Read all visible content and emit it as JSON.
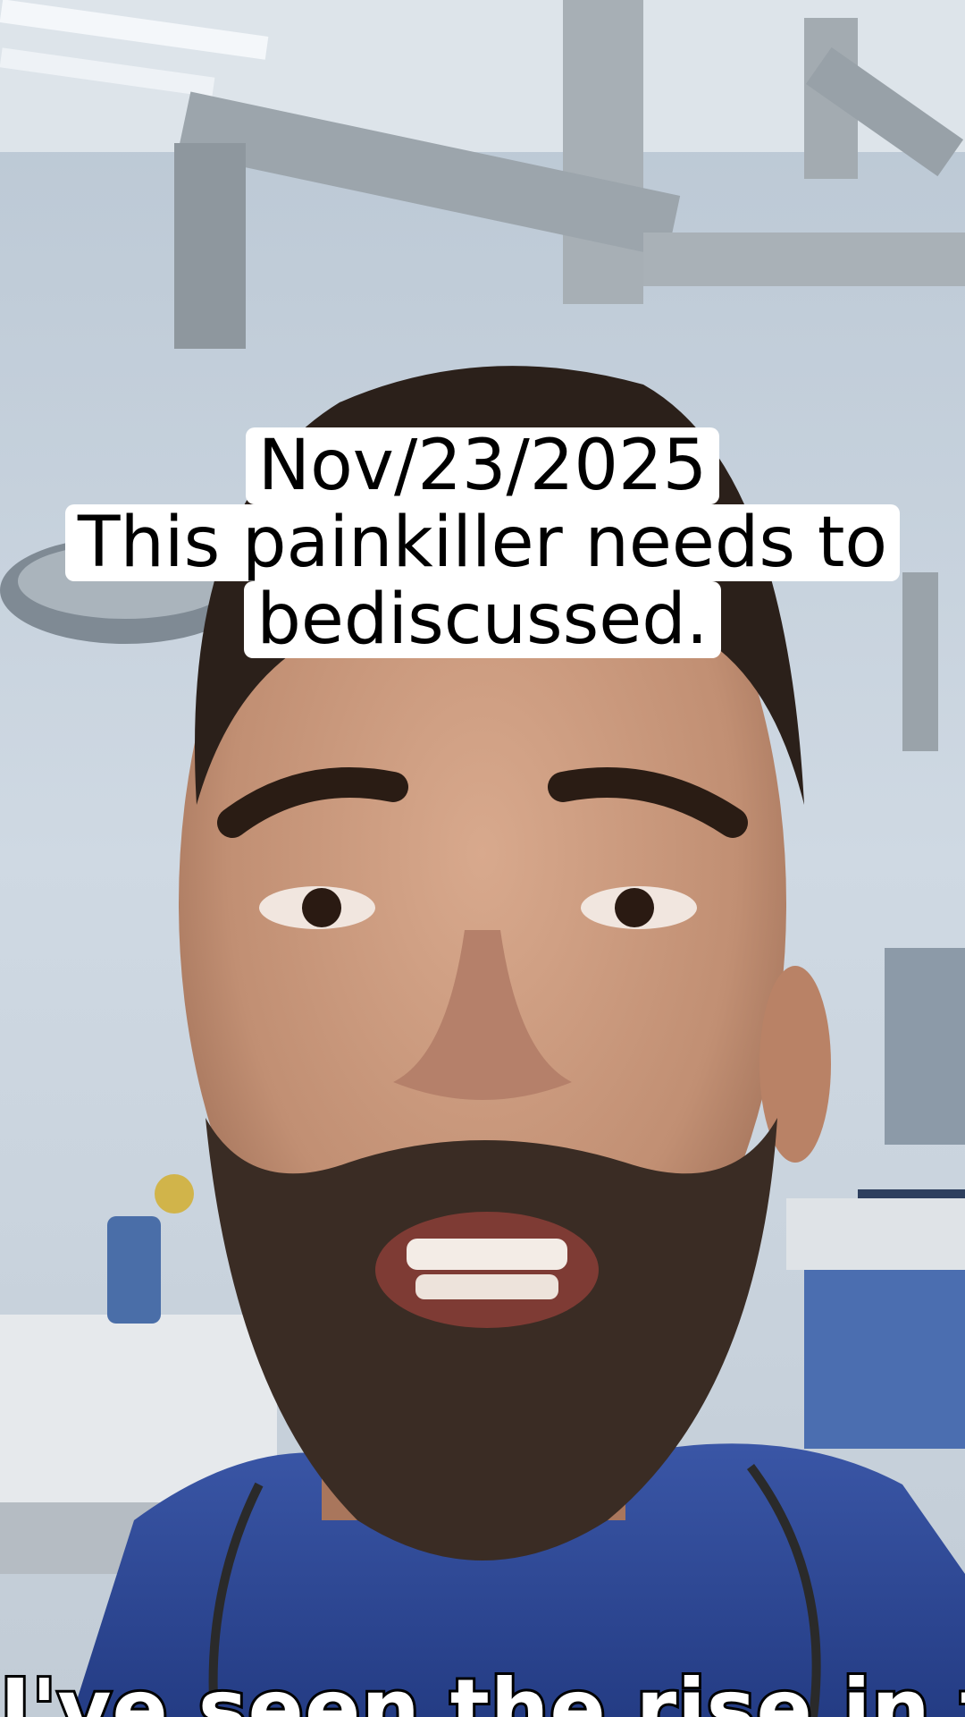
{
  "overlay": {
    "date": "Nov/23/2025",
    "headline_line1": "This painkiller needs to",
    "headline_line2": "bediscussed."
  },
  "subtitle": "I've seen the rise in this",
  "colors": {
    "wall": "#c9d4de",
    "scrubs": "#2f4a9a",
    "skin": "#c99a80",
    "hair": "#2b201a",
    "caption_bg": "#ffffff"
  }
}
